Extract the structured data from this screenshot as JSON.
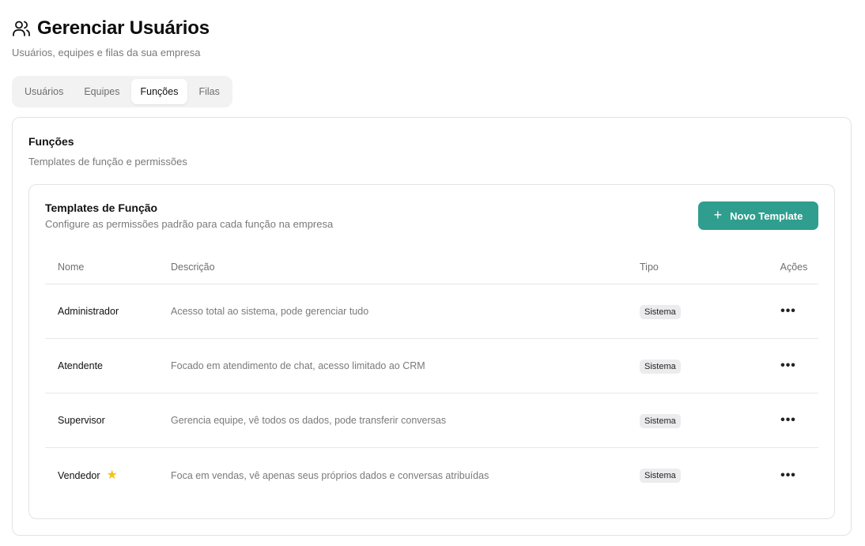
{
  "header": {
    "title": "Gerenciar Usuários",
    "subtitle": "Usuários, equipes e filas da sua empresa",
    "icon": "users-icon"
  },
  "tabs": [
    {
      "label": "Usuários",
      "active": false
    },
    {
      "label": "Equipes",
      "active": false
    },
    {
      "label": "Funções",
      "active": true
    },
    {
      "label": "Filas",
      "active": false
    }
  ],
  "section": {
    "title": "Funções",
    "subtitle": "Templates de função e permissões"
  },
  "templates": {
    "title": "Templates de Função",
    "subtitle": "Configure as permissões padrão para cada função na empresa",
    "new_button_label": "Novo Template",
    "accent_color": "#2f9e8f",
    "columns": {
      "name": "Nome",
      "description": "Descrição",
      "type": "Tipo",
      "actions": "Ações"
    },
    "rows": [
      {
        "name": "Administrador",
        "description": "Acesso total ao sistema, pode gerenciar tudo",
        "type": "Sistema",
        "default": false
      },
      {
        "name": "Atendente",
        "description": "Focado em atendimento de chat, acesso limitado ao CRM",
        "type": "Sistema",
        "default": false
      },
      {
        "name": "Supervisor",
        "description": "Gerencia equipe, vê todos os dados, pode transferir conversas",
        "type": "Sistema",
        "default": false
      },
      {
        "name": "Vendedor",
        "description": "Foca em vendas, vê apenas seus próprios dados e conversas atribuídas",
        "type": "Sistema",
        "default": true
      }
    ],
    "actions_glyph": "•••",
    "star_glyph": "★"
  }
}
